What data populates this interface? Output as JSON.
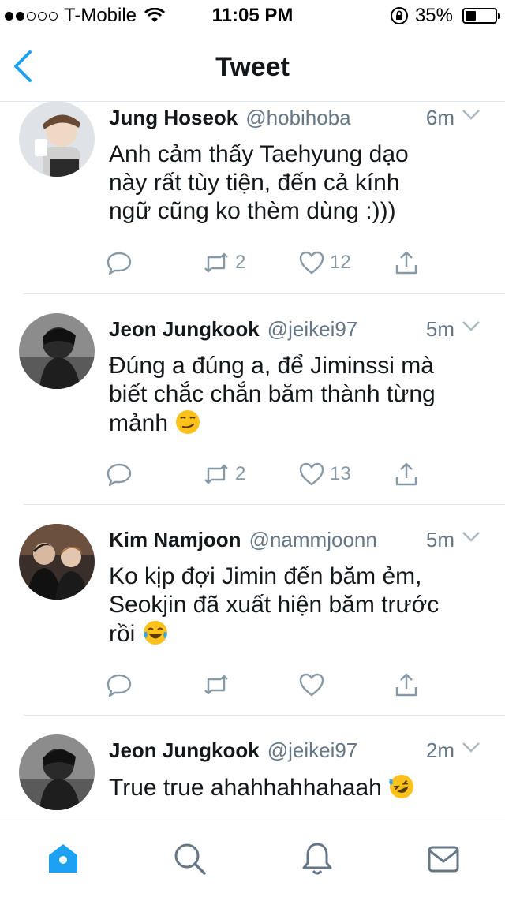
{
  "status": {
    "carrier": "T-Mobile",
    "time": "11:05 PM",
    "battery": "35%",
    "battery_level": 0.35,
    "signal_bars": 2
  },
  "nav": {
    "title": "Tweet",
    "back_icon": "chevron-left-icon"
  },
  "tweets": [
    {
      "name": "Jung Hoseok",
      "handle": "@hobihoba",
      "time": "6m",
      "lines": [
        "Anh cảm thấy Taehyung dạo",
        "này rất tùy tiện, đến cả kính",
        "ngữ cũng ko thèm dùng :)))"
      ],
      "retweets": "2",
      "likes": "12"
    },
    {
      "name": "Jeon Jungkook",
      "handle": "@jeikei97",
      "time": "5m",
      "lines": [
        "Đúng a đúng a, để Jiminssi mà",
        "biết chắc chắn băm thành từng",
        "mảnh"
      ],
      "emoji": "smirk-emoji",
      "retweets": "2",
      "likes": "13"
    },
    {
      "name": "Kim Namjoon",
      "handle": "@nammjoonn",
      "time": "5m",
      "lines": [
        "Ko kịp đợi Jimin đến băm ẻm,",
        "Seokjin đã xuất hiện băm trước",
        "rồi"
      ],
      "emoji": "tears-of-joy-emoji",
      "retweets": "",
      "likes": ""
    },
    {
      "name": "Jeon Jungkook",
      "handle": "@jeikei97",
      "time": "2m",
      "lines": [
        "True true ahahhahhahaah"
      ],
      "emoji": "rofl-emoji"
    }
  ],
  "tabs": [
    "home-icon",
    "search-icon",
    "notifications-icon",
    "messages-icon"
  ],
  "colors": {
    "accent": "#1da1f2",
    "text": "#14171a",
    "secondary": "#657786",
    "icon": "#8899a6",
    "divider": "#e1e8ed"
  }
}
